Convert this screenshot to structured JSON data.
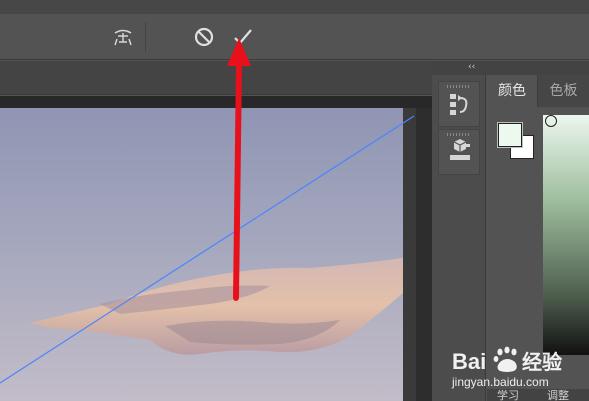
{
  "toolbar": {
    "icons": [
      "warp-icon",
      "cancel-icon",
      "commit-checkmark-icon"
    ]
  },
  "panel_dock": {
    "collapse_label": "‹‹",
    "icon_slots": [
      "history-icon",
      "3d-icon"
    ]
  },
  "color_panel": {
    "tabs": [
      {
        "label": "颜色",
        "active": true
      },
      {
        "label": "色板",
        "active": false
      }
    ],
    "foreground_color": "#ecf9ee",
    "background_color": "#ffffff",
    "bottom_tabs": [
      "学习",
      "调整"
    ]
  },
  "annotation": {
    "arrow_color": "#e8101a",
    "guide_line_color": "#4a84ff"
  },
  "watermark": {
    "brand": "Baidu",
    "brand_cn": "经验",
    "url": "jingyan.baidu.com"
  }
}
